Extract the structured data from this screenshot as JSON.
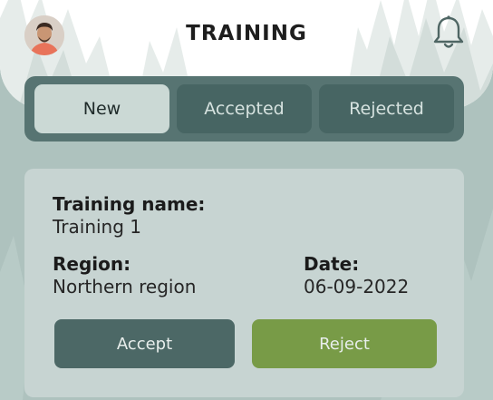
{
  "header": {
    "title": "TRAINING",
    "avatar_icon": "user-avatar",
    "notification_icon": "bell-icon"
  },
  "tabs": [
    {
      "label": "New",
      "active": true
    },
    {
      "label": "Accepted",
      "active": false
    },
    {
      "label": "Rejected",
      "active": false
    }
  ],
  "card": {
    "training_name_label": "Training name:",
    "training_name_value": "Training 1",
    "region_label": "Region:",
    "region_value": "Northern region",
    "date_label": "Date:",
    "date_value": "06-09-2022",
    "accept_label": "Accept",
    "reject_label": "Reject"
  },
  "colors": {
    "background": "#aec2be",
    "tabbar": "#577472",
    "tab_inactive": "#476563",
    "tab_active": "#cbd9d5",
    "card": "#c7d4d2",
    "accept": "#4c6866",
    "reject": "#789b47"
  }
}
